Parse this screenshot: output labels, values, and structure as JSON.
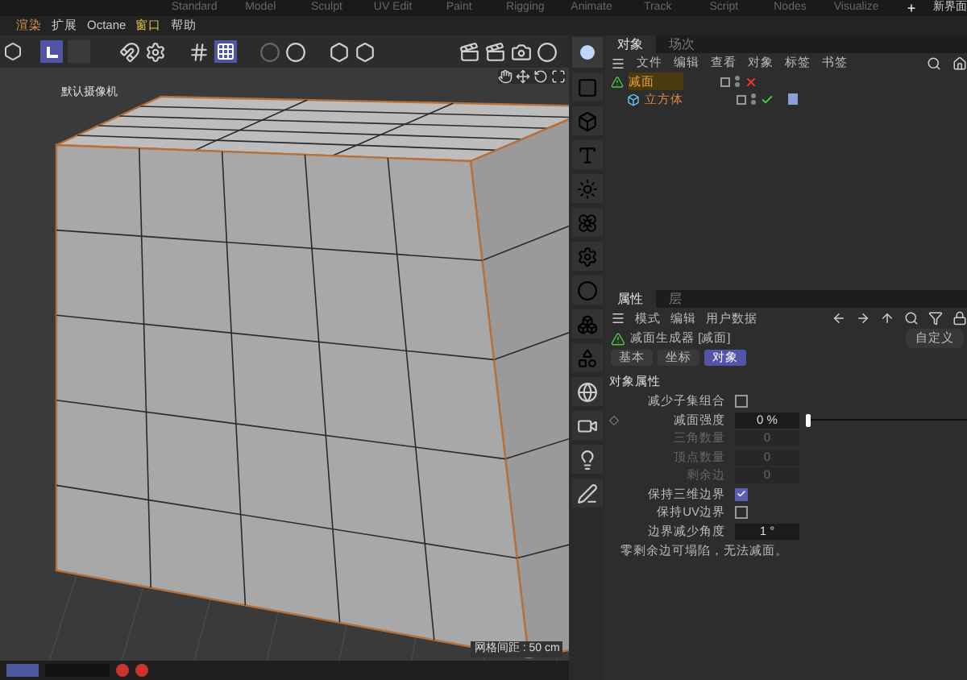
{
  "layout_tabs": [
    {
      "label": "Standard",
      "selected": false
    },
    {
      "label": "Model",
      "selected": false
    },
    {
      "label": "Sculpt",
      "selected": false
    },
    {
      "label": "UV Edit",
      "selected": false
    },
    {
      "label": "Paint",
      "selected": false
    },
    {
      "label": "Rigging",
      "selected": false
    },
    {
      "label": "Animate",
      "selected": false
    },
    {
      "label": "Track",
      "selected": false
    },
    {
      "label": "Script",
      "selected": false
    },
    {
      "label": "Nodes",
      "selected": false
    },
    {
      "label": "Visualize",
      "selected": false
    }
  ],
  "add_layout": "+",
  "new_layout": "新界面",
  "menu": [
    {
      "label": "渲染",
      "color": "#e09a4a"
    },
    {
      "label": "扩展",
      "color": "#c8c8c8"
    },
    {
      "label": "Octane",
      "color": "#c8c8c8"
    },
    {
      "label": "窗口",
      "color": "#e0c040"
    },
    {
      "label": "帮助",
      "color": "#c8c8c8"
    }
  ],
  "viewport": {
    "camera": "默认摄像机",
    "grid_spacing": "网格间距 : 50 cm"
  },
  "object_panel": {
    "tabs": [
      {
        "label": "对象",
        "selected": true
      },
      {
        "label": "场次",
        "selected": false
      }
    ],
    "menu": [
      "文件",
      "编辑",
      "查看",
      "对象",
      "标签",
      "书签"
    ],
    "tree": [
      {
        "name": "减面",
        "enabled": false,
        "children": [
          {
            "name": "立方体",
            "enabled": true
          }
        ]
      }
    ]
  },
  "attributes": {
    "tabs": [
      {
        "label": "属性",
        "selected": true
      },
      {
        "label": "层",
        "selected": false
      }
    ],
    "menu": [
      "模式",
      "编辑",
      "用户数据"
    ],
    "title": "减面生成器 [减面]",
    "custom_button": "自定义",
    "sub_tabs": [
      {
        "label": "基本",
        "selected": false
      },
      {
        "label": "坐标",
        "selected": false
      },
      {
        "label": "对象",
        "selected": true
      }
    ],
    "section": "对象属性",
    "rows": [
      {
        "kind": "checkbox",
        "label": "减少子集组合",
        "checked": false
      },
      {
        "kind": "slider",
        "label": "减面强度",
        "value": "0 %",
        "level": 0
      },
      {
        "kind": "number",
        "label": "三角数量",
        "value": "0",
        "disabled": true
      },
      {
        "kind": "number",
        "label": "顶点数量",
        "value": "0",
        "disabled": true
      },
      {
        "kind": "number",
        "label": "剩余边",
        "value": "0",
        "disabled": true
      },
      {
        "kind": "checkbox",
        "label": "保持三维边界",
        "checked": true
      },
      {
        "kind": "checkbox",
        "label": "保持UV边界",
        "checked": false
      },
      {
        "kind": "number",
        "label": "边界减少角度",
        "value": "1 °",
        "disabled": false
      }
    ],
    "note": "零剩余边可塌陷，无法减面。"
  }
}
